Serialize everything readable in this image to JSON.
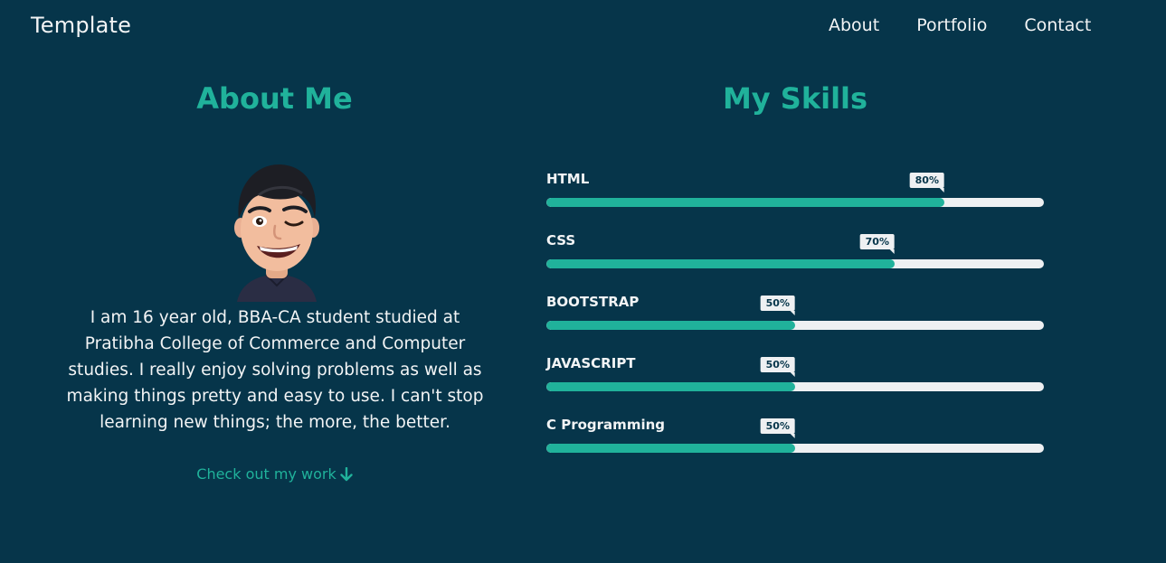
{
  "header": {
    "brand": "Template",
    "nav": [
      "About",
      "Portfolio",
      "Contact"
    ]
  },
  "about": {
    "title": "About Me",
    "avatar_icon": "avatar-memoji-icon",
    "text": "I am 16 year old, BBA-CA student studied at Pratibha College of Commerce and Computer studies. I really enjoy solving problems as well as making things pretty and easy to use. I can't stop learning new things; the more, the better.",
    "link": "Check out my work",
    "link_icon": "arrow-down-icon"
  },
  "skills": {
    "title": "My Skills",
    "items": [
      {
        "name": "HTML",
        "percent": 80,
        "label": "80%"
      },
      {
        "name": "CSS",
        "percent": 70,
        "label": "70%"
      },
      {
        "name": "BOOTSTRAP",
        "percent": 50,
        "label": "50%"
      },
      {
        "name": "JAVASCRIPT",
        "percent": 50,
        "label": "50%"
      },
      {
        "name": "C Programming",
        "percent": 50,
        "label": "50%"
      }
    ]
  },
  "colors": {
    "background": "#06354a",
    "accent": "#20b29b",
    "text": "#f2f4f5",
    "track": "#eef0f2"
  }
}
